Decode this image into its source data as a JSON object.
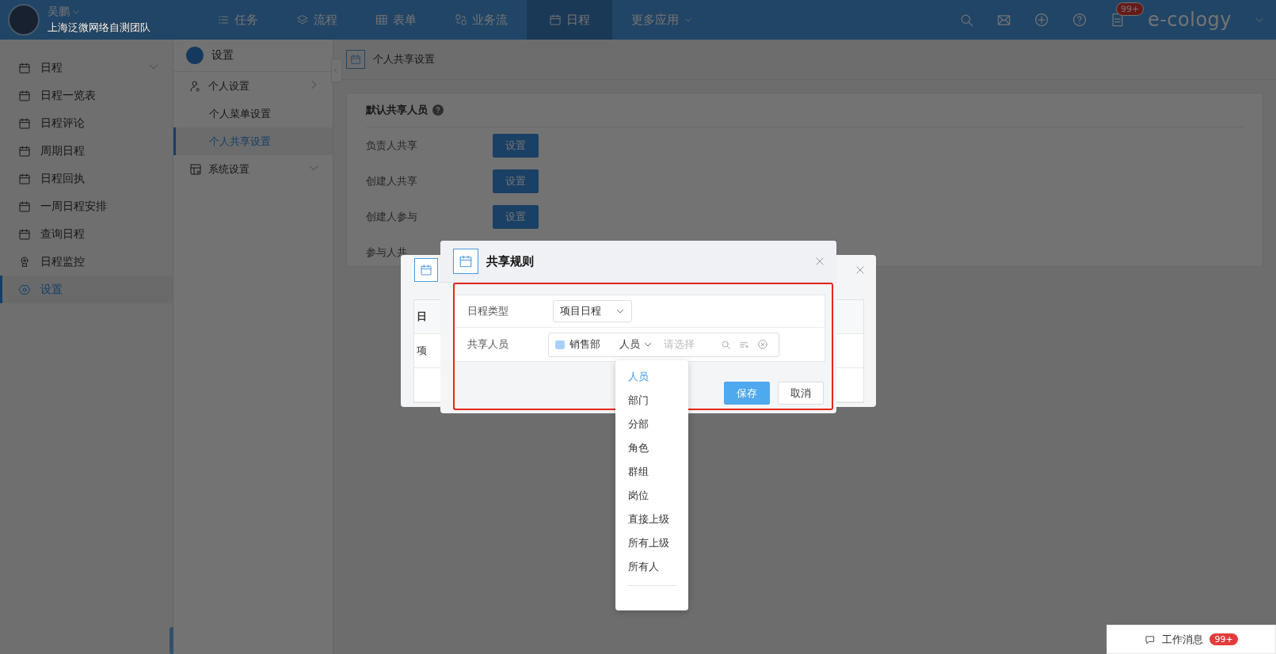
{
  "top_bar": {
    "user": {
      "name": "吴鹏",
      "org": "上海泛微网络自测团队"
    },
    "nav": [
      {
        "label": "任务",
        "kind": "link",
        "selected": false
      },
      {
        "label": "流程",
        "kind": "link",
        "selected": false
      },
      {
        "label": "表单",
        "kind": "link",
        "selected": false
      },
      {
        "label": "业务流",
        "kind": "link",
        "selected": false
      },
      {
        "label": "日程",
        "kind": "link",
        "selected": true
      },
      {
        "label": "更多应用",
        "kind": "dropdown",
        "selected": false
      }
    ],
    "notification_badge": "99+",
    "brand": "e-cology"
  },
  "sidebar": {
    "items": [
      {
        "label": "日程",
        "kind": "group",
        "selected": false
      },
      {
        "label": "日程一览表",
        "kind": "item",
        "selected": false
      },
      {
        "label": "日程评论",
        "kind": "item",
        "selected": false
      },
      {
        "label": "周期日程",
        "kind": "item",
        "selected": false
      },
      {
        "label": "日程回执",
        "kind": "item",
        "selected": false
      },
      {
        "label": "一周日程安排",
        "kind": "item",
        "selected": false
      },
      {
        "label": "查询日程",
        "kind": "item",
        "selected": false
      },
      {
        "label": "日程监控",
        "kind": "item",
        "selected": false
      },
      {
        "label": "设置",
        "kind": "item",
        "selected": true
      }
    ]
  },
  "submenu": {
    "title": "设置",
    "items": [
      {
        "label": "个人设置",
        "children": [
          {
            "label": "个人菜单设置",
            "selected": false
          },
          {
            "label": "个人共享设置",
            "selected": true
          }
        ]
      },
      {
        "label": "系统设置"
      }
    ]
  },
  "page": {
    "title": "个人共享设置",
    "section_title": "默认共享人员",
    "rows": [
      {
        "label": "负责人共享",
        "button": "设置"
      },
      {
        "label": "创建人共享",
        "button": "设置"
      },
      {
        "label": "创建人参与",
        "button": "设置"
      },
      {
        "label": "参与人共"
      }
    ]
  },
  "back_dialog": {
    "cells": [
      "日",
      "项"
    ]
  },
  "dialog": {
    "title": "共享规则",
    "fields": [
      {
        "kind": "select",
        "label": "日程类型",
        "value": "项目日程"
      },
      {
        "kind": "browser",
        "label": "共享人员",
        "tag": "销售部",
        "type_value": "人员",
        "placeholder": "请选择"
      }
    ],
    "buttons": [
      {
        "label": "保存",
        "kind": "primary"
      },
      {
        "label": "取消",
        "kind": "default"
      }
    ]
  },
  "dropdown": {
    "options": [
      {
        "label": "人员",
        "selected": true
      },
      {
        "label": "部门",
        "selected": false
      },
      {
        "label": "分部",
        "selected": false
      },
      {
        "label": "角色",
        "selected": false
      },
      {
        "label": "群组",
        "selected": false
      },
      {
        "label": "岗位",
        "selected": false
      },
      {
        "label": "直接上级",
        "selected": false
      },
      {
        "label": "所有上级",
        "selected": false
      },
      {
        "label": "所有人",
        "selected": false
      }
    ]
  },
  "message_bar": {
    "label": "工作消息",
    "badge": "99+"
  }
}
